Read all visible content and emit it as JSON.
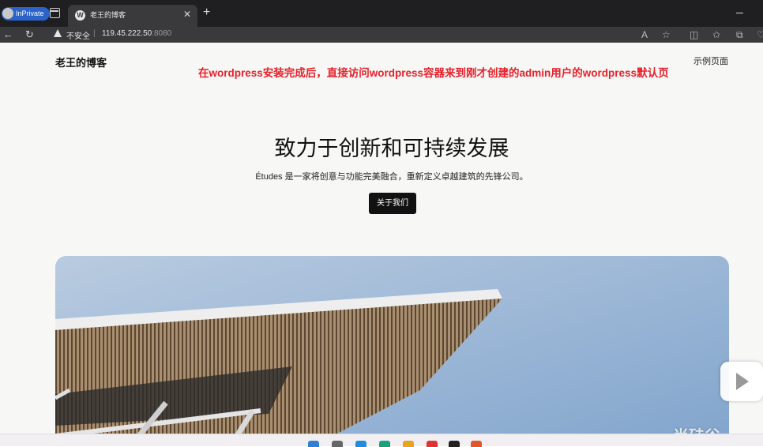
{
  "browser": {
    "inprivate_label": "InPrivate",
    "tab_title": "老王的博客",
    "tab_icon": "wordpress-icon",
    "insecure_label": "不安全",
    "address_separator": "|",
    "url_host": "119.45.222.50",
    "url_port": ":8080"
  },
  "site": {
    "title": "老王的博客",
    "nav_link": "示例页面"
  },
  "annotation": "在wordpress安装完成后，直接访问wordpress容器来到刚才创建的admin用户的wordpress默认页",
  "hero": {
    "heading": "致力于创新和可持续发展",
    "subheading": "Études 是一家将创意与功能完美融合，重新定义卓越建筑的先锋公司。",
    "button_label": "关于我们"
  },
  "overlay": {
    "watermark": "尚硅谷"
  },
  "colors": {
    "annotation": "#e8202a",
    "accent_button": "#111111",
    "inprivate_badge": "#2b63c9",
    "sky": "#8fb0d4"
  }
}
